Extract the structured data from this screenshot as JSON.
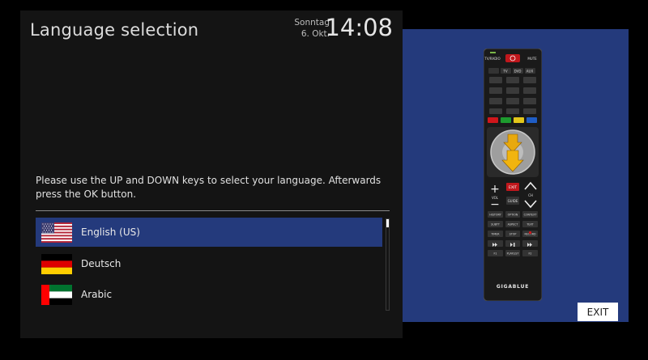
{
  "header": {
    "title": "Language selection",
    "weekday": "Sonntag",
    "date": "6. Okt.",
    "time": "14:08"
  },
  "instructions": "Please use the UP and DOWN keys to select your language. Afterwards press the OK button.",
  "languages": [
    {
      "label": "English (US)",
      "flag": "us-flag-icon",
      "selected": true
    },
    {
      "label": "Deutsch",
      "flag": "germany-flag-icon",
      "selected": false
    },
    {
      "label": "Arabic",
      "flag": "uae-flag-icon",
      "selected": false
    }
  ],
  "remote": {
    "brand": "GIGABLUE",
    "top_labels": [
      "TV/RADIO",
      "MUTE"
    ],
    "source_labels": [
      "TV",
      "DVD",
      "AUX"
    ],
    "exit_key": "EXIT",
    "guide_key": "GUIDE",
    "vol_label": "VOL",
    "ch_label": "CH",
    "func_row1": [
      "HISTORY",
      "OPTION",
      "CONTEXT"
    ],
    "func_row2": [
      "SUBTT",
      "ASPECT",
      "TEXT"
    ],
    "func_row3": [
      "TIMER",
      "STOP",
      "RECORD"
    ],
    "func_row4": [
      "F1",
      "PLAYLIST",
      "F2"
    ]
  },
  "buttons": {
    "exit": "EXIT"
  },
  "colors": {
    "background": "#000000",
    "panel": "#141414",
    "accent_blue": "#243a7c",
    "text": "#e0e0e0"
  }
}
